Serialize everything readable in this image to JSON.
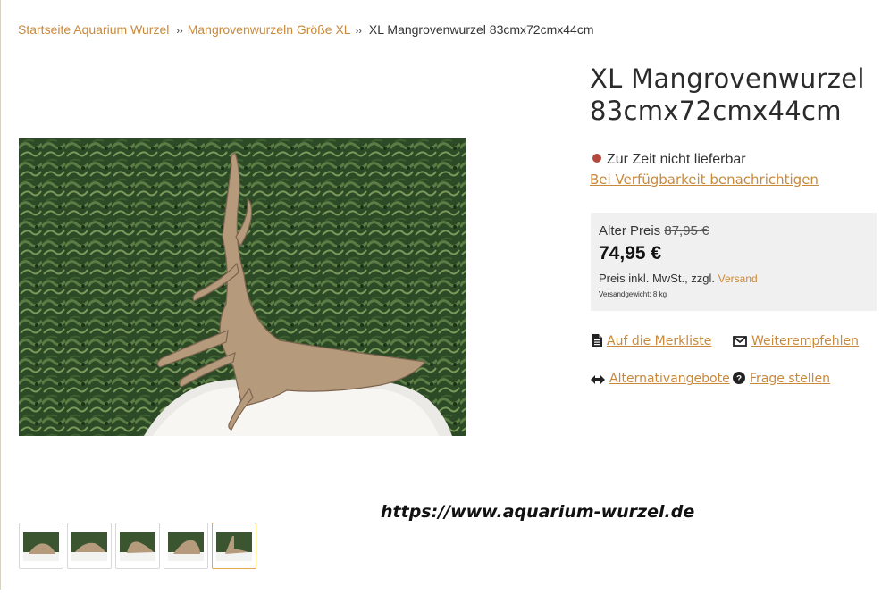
{
  "breadcrumb": {
    "home": "Startseite Aquarium Wurzel",
    "category": "Mangrovenwurzeln Größe XL",
    "current": "XL Mangrovenwurzel 83cmx72cmx44cm",
    "separator": "››"
  },
  "product": {
    "title": "XL Mangrovenwurzel 83cmx72cmx44cm",
    "availability": "Zur Zeit nicht lieferbar",
    "notify_link": "Bei Verfügbarkeit benachrichtigen"
  },
  "pricing": {
    "old_price_label": "Alter Preis",
    "old_price": "87,95 €",
    "price": "74,95 €",
    "tax_note": "Preis inkl. MwSt., zzgl.",
    "shipping_link": "Versand",
    "weight": "Versandgewicht: 8 kg"
  },
  "actions": {
    "wishlist": "Auf die Merkliste",
    "recommend": "Weiterempfehlen",
    "alternatives": "Alternativangebote",
    "question": "Frage stellen"
  },
  "watermark": "https://www.aquarium-wurzel.de",
  "gallery": {
    "active_index": 4,
    "count": 5
  },
  "colors": {
    "accent": "#c9893a",
    "unavailable_dot": "#b5483e",
    "price_box_bg": "#f0f0f0",
    "active_thumb_border": "#e4a94e"
  },
  "icons": {
    "wishlist": "document-icon",
    "recommend": "envelope-icon",
    "alternatives": "arrows-left-right-icon",
    "question": "question-circle-icon"
  }
}
